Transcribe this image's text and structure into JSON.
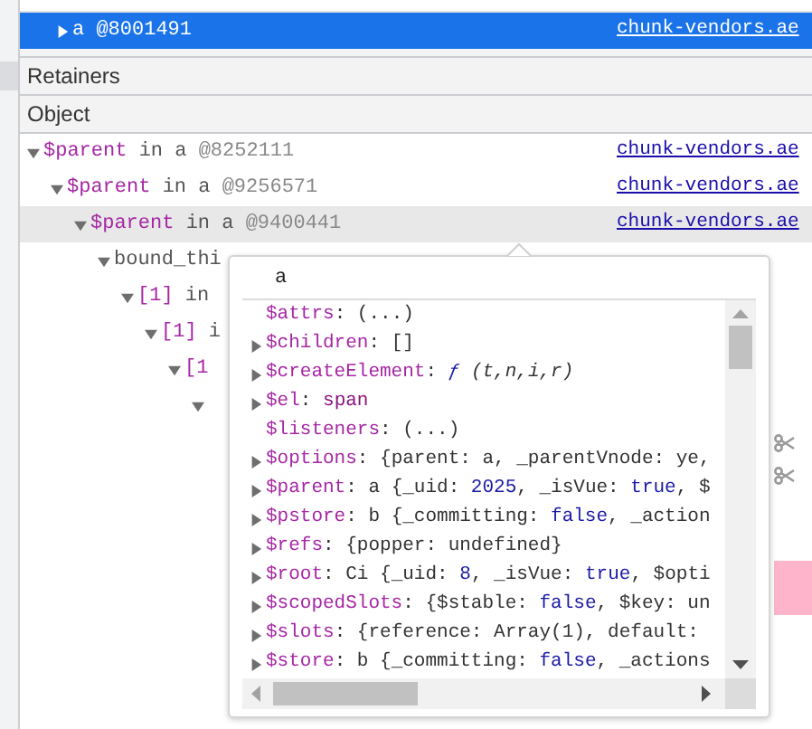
{
  "selected_row": {
    "label": "a @8001491",
    "link": "chunk-vendors.ae",
    "selected": true
  },
  "retainers": {
    "title": "Retainers",
    "column": "Object",
    "rows": [
      {
        "name": "$parent",
        "rest": " in a ",
        "id": "@8252111",
        "link": "chunk-vendors.ae",
        "highlighted": false,
        "expanded": true,
        "children": [
          {
            "name": "$parent",
            "rest": " in a ",
            "id": "@9256571",
            "link": "chunk-vendors.ae",
            "highlighted": false,
            "expanded": true,
            "children": [
              {
                "name": "$parent",
                "rest": " in a ",
                "id": "@9400441",
                "link": "chunk-vendors.ae",
                "highlighted": true,
                "expanded": true,
                "children": [
                  {
                    "name": "bound_thi",
                    "kind": "plain",
                    "expanded": true,
                    "children": [
                      {
                        "name": "[1]",
                        "rest": " in",
                        "expanded": true,
                        "children": [
                          {
                            "name": "[1]",
                            "rest": " i",
                            "expanded": true,
                            "children": [
                              {
                                "name": "[1",
                                "expanded": true,
                                "children": [
                                  {
                                    "expanded": true
                                  }
                                ]
                              }
                            ]
                          }
                        ]
                      }
                    ]
                  }
                ]
              }
            ]
          }
        ]
      }
    ]
  },
  "popover": {
    "title": "a",
    "properties": [
      {
        "name": "$attrs",
        "expandable": false,
        "value": [
          {
            "t": ": (...)",
            "kind": "plain"
          }
        ]
      },
      {
        "name": "$children",
        "expandable": true,
        "value": [
          {
            "t": ": []",
            "kind": "plain"
          }
        ]
      },
      {
        "name": "$createElement",
        "expandable": true,
        "value": [
          {
            "t": ": ",
            "kind": "plain"
          },
          {
            "t": "ƒ",
            "kind": "function"
          },
          {
            "t": " (t,n,i,r)",
            "kind": "italic"
          }
        ]
      },
      {
        "name": "$el",
        "expandable": true,
        "value": [
          {
            "t": ": ",
            "kind": "plain"
          },
          {
            "t": "span",
            "kind": "tag"
          }
        ]
      },
      {
        "name": "$listeners",
        "expandable": false,
        "value": [
          {
            "t": ": (...)",
            "kind": "plain"
          }
        ]
      },
      {
        "name": "$options",
        "expandable": true,
        "value": [
          {
            "t": ": {parent: a, _parentVnode: ye,",
            "kind": "plain"
          }
        ]
      },
      {
        "name": "$parent",
        "expandable": true,
        "value": [
          {
            "t": ": a {_uid: ",
            "kind": "plain"
          },
          {
            "t": "2025",
            "kind": "literal"
          },
          {
            "t": ", _isVue: ",
            "kind": "plain"
          },
          {
            "t": "true",
            "kind": "literal"
          },
          {
            "t": ", $",
            "kind": "plain"
          }
        ]
      },
      {
        "name": "$pstore",
        "expandable": true,
        "value": [
          {
            "t": ": b {_committing: ",
            "kind": "plain"
          },
          {
            "t": "false",
            "kind": "literal"
          },
          {
            "t": ", _action",
            "kind": "plain"
          }
        ]
      },
      {
        "name": "$refs",
        "expandable": true,
        "value": [
          {
            "t": ": {popper: undefined}",
            "kind": "plain"
          }
        ]
      },
      {
        "name": "$root",
        "expandable": true,
        "value": [
          {
            "t": ": Ci {_uid: ",
            "kind": "plain"
          },
          {
            "t": "8",
            "kind": "literal"
          },
          {
            "t": ", _isVue: ",
            "kind": "plain"
          },
          {
            "t": "true",
            "kind": "literal"
          },
          {
            "t": ", $opti",
            "kind": "plain"
          }
        ]
      },
      {
        "name": "$scopedSlots",
        "expandable": true,
        "value": [
          {
            "t": ": {$stable: ",
            "kind": "plain"
          },
          {
            "t": "false",
            "kind": "literal"
          },
          {
            "t": ", $key: un",
            "kind": "plain"
          }
        ]
      },
      {
        "name": "$slots",
        "expandable": true,
        "value": [
          {
            "t": ": {reference: Array(1), default:",
            "kind": "plain"
          }
        ]
      },
      {
        "name": "$store",
        "expandable": true,
        "value": [
          {
            "t": ": b {_committing: ",
            "kind": "plain"
          },
          {
            "t": "false",
            "kind": "literal"
          },
          {
            "t": ", _actions",
            "kind": "plain"
          }
        ]
      }
    ]
  }
}
